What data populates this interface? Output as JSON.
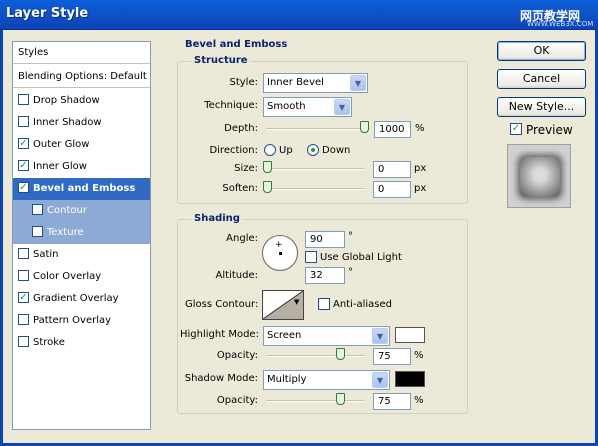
{
  "window": {
    "title": "Layer Style",
    "watermark": "网页教学网",
    "watermark_sub": "WWW.WEB3X.COM"
  },
  "styles_list": {
    "header": "Styles",
    "blending": "Blending Options: Default",
    "items": [
      {
        "label": "Drop Shadow",
        "checked": false
      },
      {
        "label": "Inner Shadow",
        "checked": false
      },
      {
        "label": "Outer Glow",
        "checked": true
      },
      {
        "label": "Inner Glow",
        "checked": true
      },
      {
        "label": "Bevel and Emboss",
        "checked": true,
        "selected": true
      },
      {
        "label": "Contour",
        "checked": false,
        "sub": true
      },
      {
        "label": "Texture",
        "checked": false,
        "sub": true
      },
      {
        "label": "Satin",
        "checked": false
      },
      {
        "label": "Color Overlay",
        "checked": false
      },
      {
        "label": "Gradient Overlay",
        "checked": true
      },
      {
        "label": "Pattern Overlay",
        "checked": false
      },
      {
        "label": "Stroke",
        "checked": false
      }
    ]
  },
  "bevel": {
    "title": "Bevel and Emboss",
    "structure": {
      "title": "Structure",
      "style_label": "Style:",
      "style_value": "Inner Bevel",
      "technique_label": "Technique:",
      "technique_value": "Smooth",
      "depth_label": "Depth:",
      "depth_value": "1000",
      "depth_unit": "%",
      "depth_level": 1.0,
      "direction_label": "Direction:",
      "dir_up": "Up",
      "dir_down": "Down",
      "direction_selected": "Down",
      "size_label": "Size:",
      "size_value": "0",
      "size_unit": "px",
      "soften_label": "Soften:",
      "soften_value": "0",
      "soften_unit": "px"
    },
    "shading": {
      "title": "Shading",
      "angle_label": "Angle:",
      "angle_value": "90",
      "angle_unit": "°",
      "global_light_label": "Use Global Light",
      "global_light": false,
      "altitude_label": "Altitude:",
      "altitude_value": "32",
      "altitude_unit": "°",
      "gloss_label": "Gloss Contour:",
      "anti_alias_label": "Anti-aliased",
      "anti_alias": false,
      "highlight_label": "Highlight Mode:",
      "highlight_mode": "Screen",
      "highlight_color": "#ffffff",
      "highlight_opacity_label": "Opacity:",
      "highlight_opacity": "75",
      "highlight_unit": "%",
      "shadow_label": "Shadow Mode:",
      "shadow_mode": "Multiply",
      "shadow_color": "#000000",
      "shadow_opacity_label": "Opacity:",
      "shadow_opacity": "75",
      "shadow_unit": "%"
    }
  },
  "buttons": {
    "ok": "OK",
    "cancel": "Cancel",
    "new_style": "New Style...",
    "preview_label": "Preview",
    "preview": true
  }
}
